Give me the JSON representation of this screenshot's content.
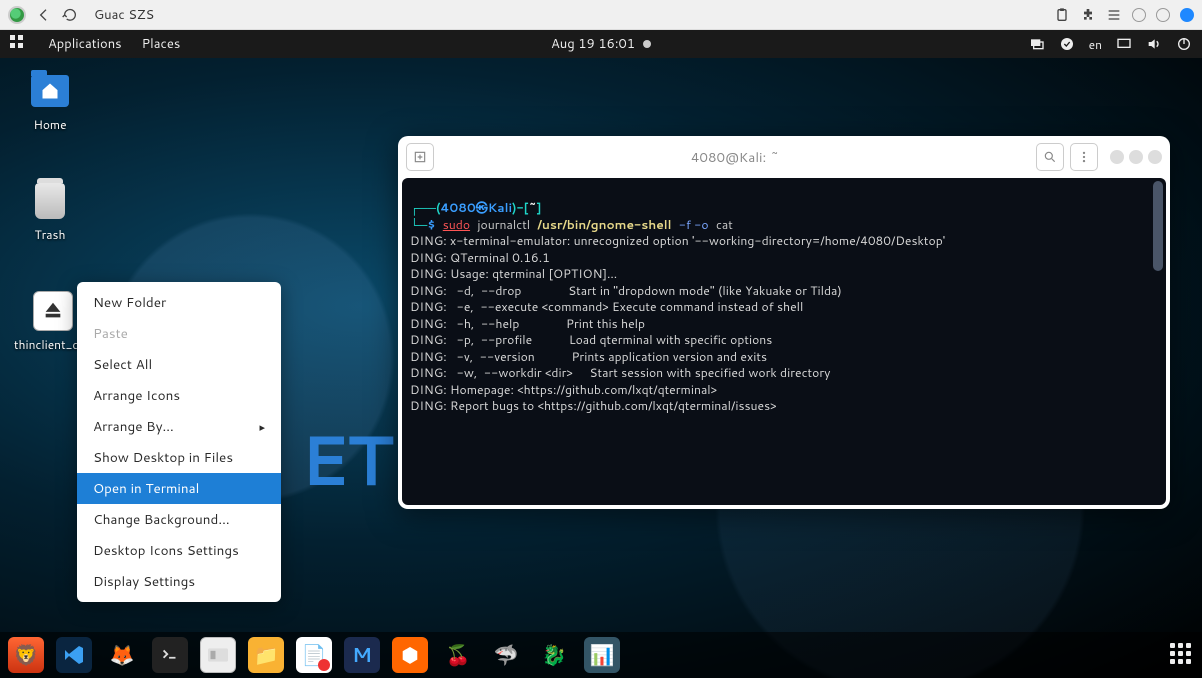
{
  "browser": {
    "title": "Guac SZS"
  },
  "gnome": {
    "apps": "Applications",
    "places": "Places",
    "clock": "Aug 19  16:01",
    "lang": "en"
  },
  "desktop_icons": {
    "home": "Home",
    "trash": "Trash",
    "thin": "thinclient_drives"
  },
  "context_menu": {
    "new_folder": "New Folder",
    "paste": "Paste",
    "select_all": "Select All",
    "arrange_icons": "Arrange Icons",
    "arrange_by": "Arrange By…",
    "show_files": "Show Desktop in Files",
    "open_term": "Open in Terminal",
    "change_bg": "Change Background…",
    "di_settings": "Desktop Icons Settings",
    "disp_settings": "Display Settings"
  },
  "terminal": {
    "title": "4080@Kali: ~",
    "prompt_host": "4080㉿Kali",
    "prompt_cwd": "~",
    "prompt_sym": "$",
    "cmd_sudo": "sudo",
    "cmd_jctl": "journalctl",
    "cmd_path": "/usr/bin/gnome-shell",
    "cmd_flags": "-f -o",
    "cmd_cat": "cat",
    "l1": "DING: x-terminal-emulator: unrecognized option '--working-directory=/home/4080/Desktop'",
    "l2": "DING: QTerminal 0.16.1",
    "l3": "DING: Usage: qterminal [OPTION]...",
    "l4": "DING:   -d,  --drop              Start in \"dropdown mode\" (like Yakuake or Tilda)",
    "l5": "DING:   -e,  --execute <command> Execute command instead of shell",
    "l6": "DING:   -h,  --help              Print this help",
    "l7": "DING:   -p,  --profile           Load qterminal with specific options",
    "l8": "DING:   -v,  --version           Prints application version and exits",
    "l9": "DING:   -w,  --workdir <dir>     Start session with specified work directory",
    "l10": "DING: Homepage: <https://github.com/lxqt/qterminal>",
    "l11": "DING: Report bugs to <https://github.com/lxqt/qterminal/issues>"
  }
}
